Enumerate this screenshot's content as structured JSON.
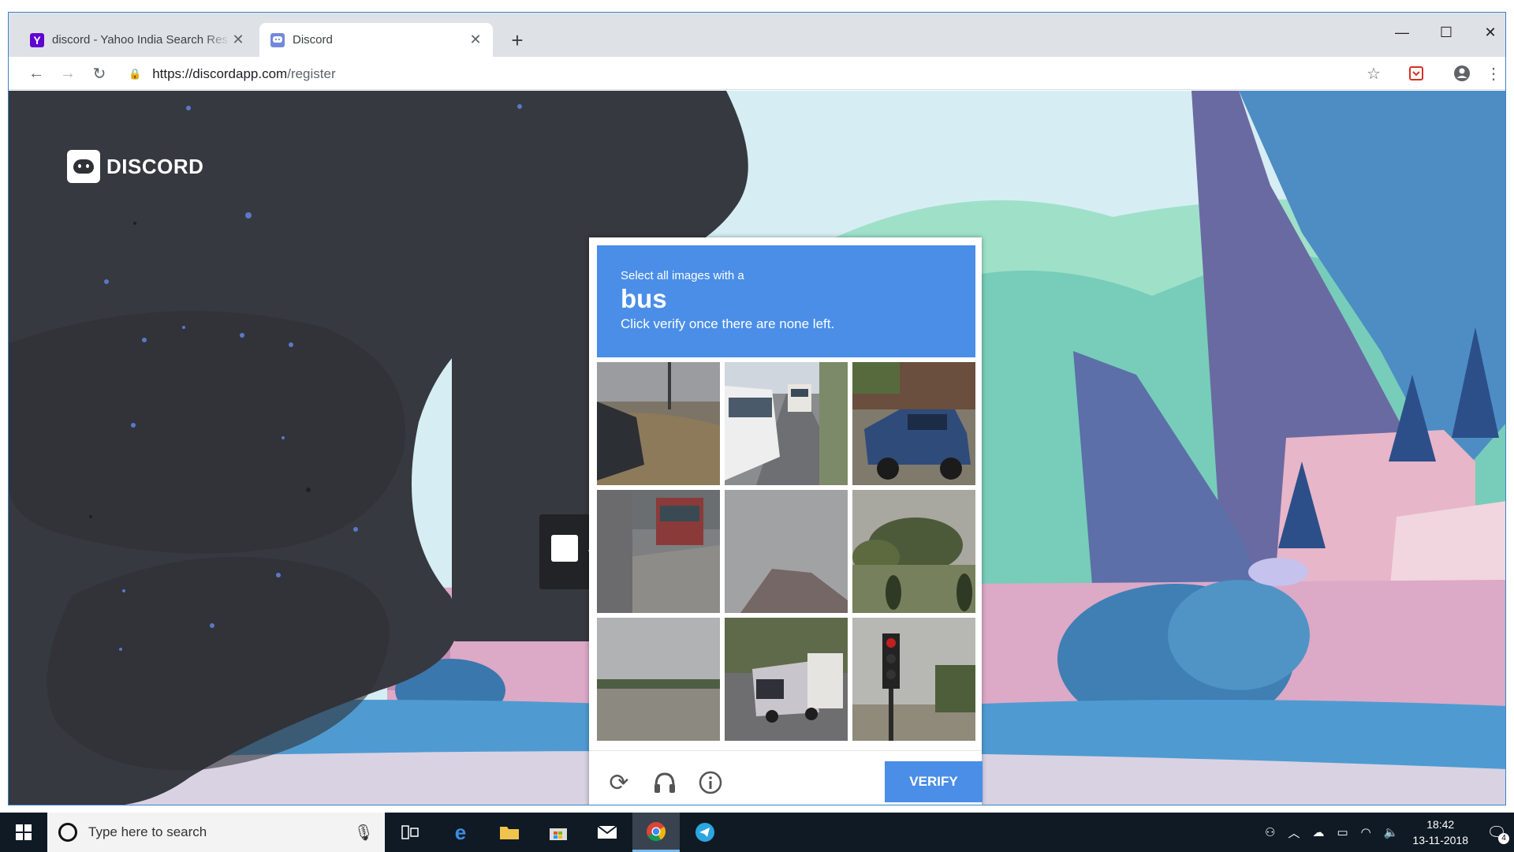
{
  "browser": {
    "tabs": [
      {
        "title": "discord - Yahoo India Search Res",
        "favicon": "Y",
        "favicon_color": "#5f01d1"
      },
      {
        "title": "Discord",
        "favicon": "discord-icon",
        "favicon_color": "#7289da"
      }
    ],
    "new_tab": "+",
    "url_host": "https://discordapp.com",
    "url_path": "/register",
    "window_controls": {
      "minimize": "—",
      "maximize": "☐",
      "close": "✕"
    }
  },
  "discord": {
    "logo_text": "DISCORD"
  },
  "captcha": {
    "instruction": "Select all images with a",
    "target": "bus",
    "subtext": "Click verify once there are none left.",
    "tiles": [
      {
        "label": "tile-car-noisy"
      },
      {
        "label": "tile-bus-road"
      },
      {
        "label": "tile-pickup-truck"
      },
      {
        "label": "tile-truck-noisy"
      },
      {
        "label": "tile-roof-noise"
      },
      {
        "label": "tile-trees"
      },
      {
        "label": "tile-field"
      },
      {
        "label": "tile-bus-street"
      },
      {
        "label": "tile-traffic-light"
      }
    ],
    "verify_label": "VERIFY",
    "accent_color": "#4a8ee8"
  },
  "taskbar": {
    "search_placeholder": "Type here to search",
    "time": "18:42",
    "date": "13-11-2018",
    "notification_count": "4"
  }
}
